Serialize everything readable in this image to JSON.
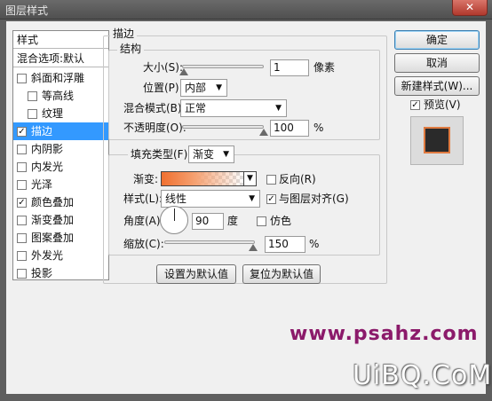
{
  "window": {
    "title": "图层样式",
    "close_glyph": "✕"
  },
  "styles_panel": {
    "header": "样式",
    "blend_default": "混合选项:默认",
    "items": [
      {
        "label": "斜面和浮雕",
        "checked": false,
        "check_glyph": ""
      },
      {
        "label": "等高线",
        "checked": false,
        "check_glyph": ""
      },
      {
        "label": "纹理",
        "checked": false,
        "check_glyph": ""
      },
      {
        "label": "描边",
        "checked": true,
        "check_glyph": "✓"
      },
      {
        "label": "内阴影",
        "checked": false,
        "check_glyph": ""
      },
      {
        "label": "内发光",
        "checked": false,
        "check_glyph": ""
      },
      {
        "label": "光泽",
        "checked": false,
        "check_glyph": ""
      },
      {
        "label": "颜色叠加",
        "checked": true,
        "check_glyph": "✓"
      },
      {
        "label": "渐变叠加",
        "checked": false,
        "check_glyph": ""
      },
      {
        "label": "图案叠加",
        "checked": false,
        "check_glyph": ""
      },
      {
        "label": "外发光",
        "checked": false,
        "check_glyph": ""
      },
      {
        "label": "投影",
        "checked": false,
        "check_glyph": ""
      }
    ]
  },
  "stroke": {
    "section_title": "描边",
    "structure_title": "结构",
    "size_label": "大小(S):",
    "size_value": "1",
    "size_unit": "像素",
    "position_label": "位置(P):",
    "position_value": "内部",
    "blend_label": "混合模式(B):",
    "blend_value": "正常",
    "opacity_label": "不透明度(O):",
    "opacity_value": "100",
    "opacity_unit": "%",
    "fill_type_label": "填充类型(F):",
    "fill_type_value": "渐变",
    "gradient_label": "渐变:",
    "reverse_label": "反向(R)",
    "reverse_checked": false,
    "style_label": "样式(L):",
    "style_value": "线性",
    "align_label": "与图层对齐(G)",
    "align_checked": true,
    "angle_label": "角度(A):",
    "angle_value": "90",
    "angle_unit": "度",
    "dither_label": "仿色",
    "dither_checked": false,
    "scale_label": "缩放(C):",
    "scale_value": "150",
    "scale_unit": "%",
    "set_default_label": "设置为默认值",
    "reset_default_label": "复位为默认值"
  },
  "side_buttons": {
    "ok": "确定",
    "cancel": "取消",
    "new_style": "新建样式(W)...",
    "preview_label": "预览(V)",
    "preview_checked": true,
    "check_glyph": "✓"
  },
  "watermarks": {
    "site1": "www.psahz.com",
    "site2": "UiBQ.CoM"
  },
  "colors": {
    "selection": "#3399ff",
    "gradient_start": "#f07030",
    "preview_fill": "#2a2a2a",
    "watermark1": "#8b1a6a"
  }
}
